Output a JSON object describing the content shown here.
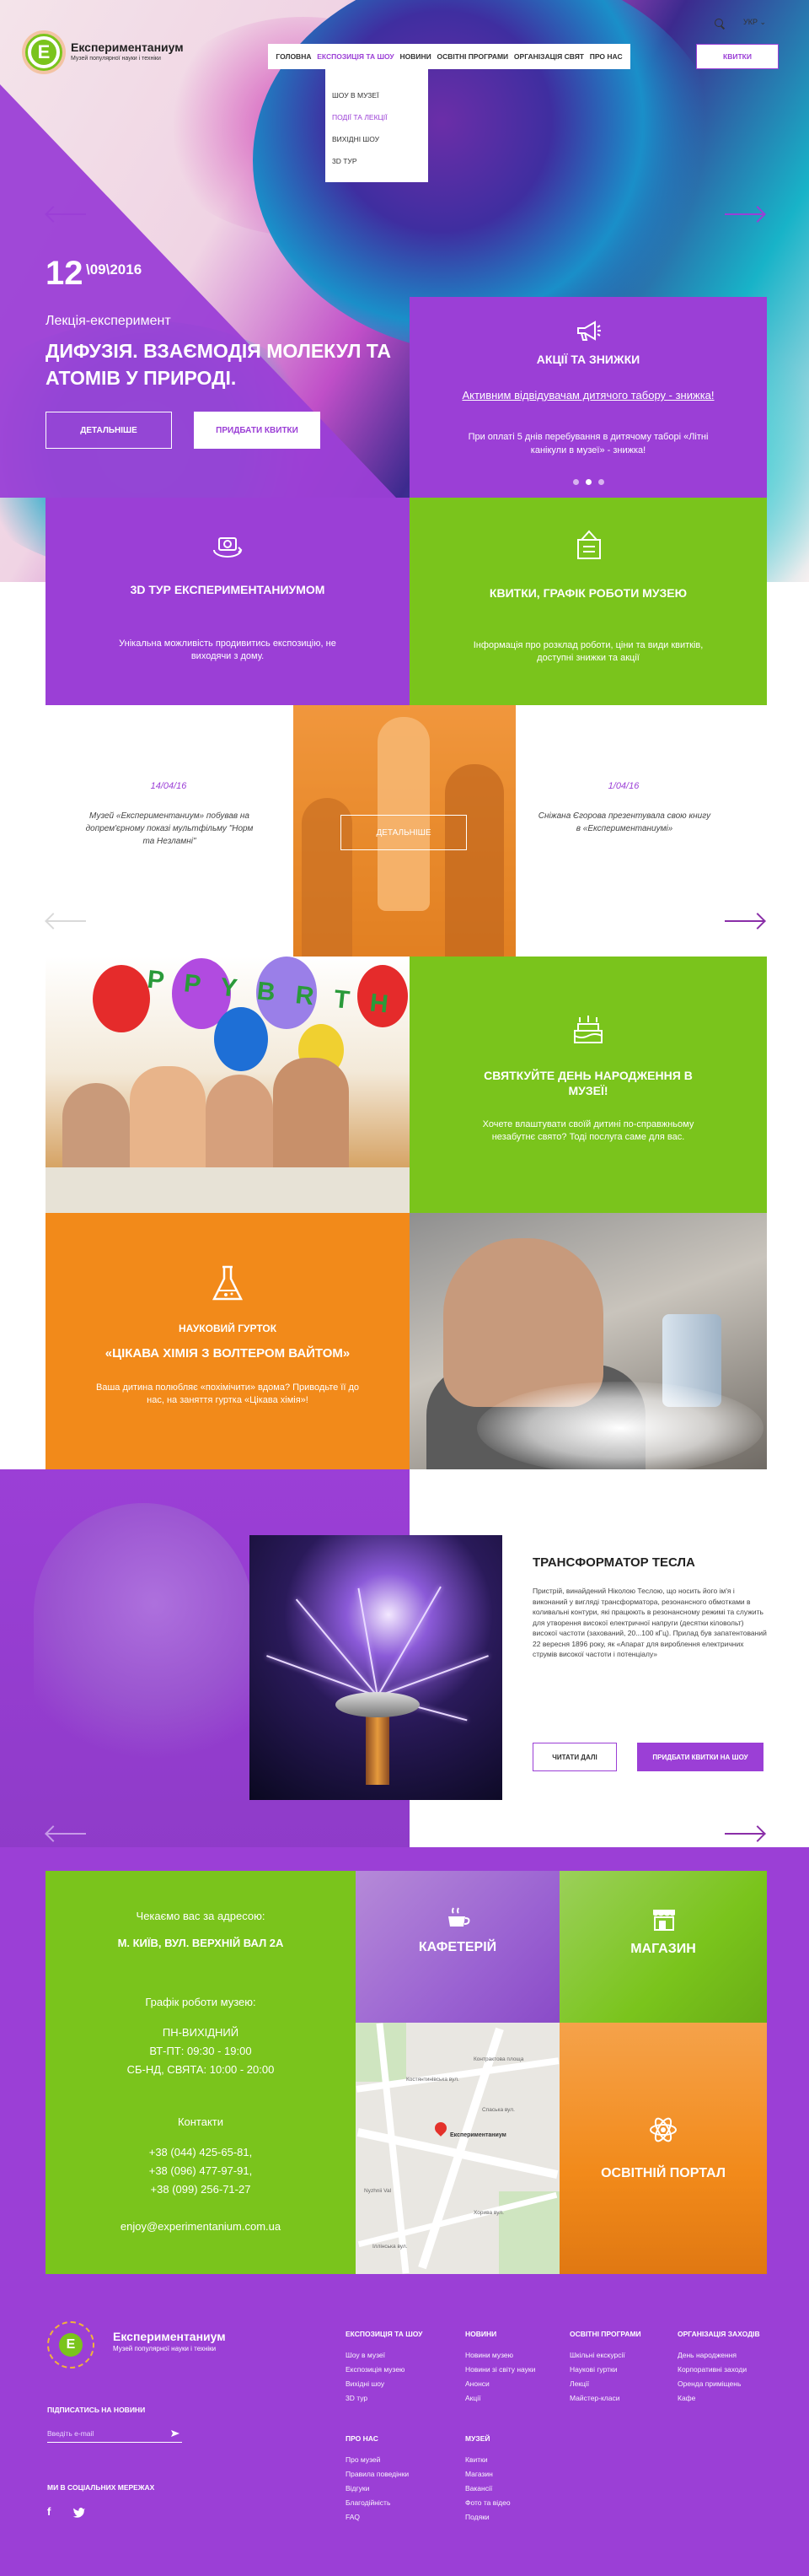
{
  "header": {
    "logo_letter": "E",
    "logo_name": "Експериментаниум",
    "logo_sub": "Музей популярної науки і техніки",
    "lang": "УКР ⌄",
    "tickets_button": "Квитки",
    "nav": [
      {
        "label": "Головна"
      },
      {
        "label": "Експозиція та шоу",
        "active": true
      },
      {
        "label": "Новини"
      },
      {
        "label": "Освітні програми"
      },
      {
        "label": "Організація свят"
      },
      {
        "label": "Про нас"
      }
    ],
    "dropdown": [
      {
        "label": "Шоу в музеї"
      },
      {
        "label": "Події та лекції",
        "active": true
      },
      {
        "label": "Вихідні шоу"
      },
      {
        "label": "3D тур"
      }
    ]
  },
  "hero": {
    "date_day": "12",
    "date_rest": "\\09\\2016",
    "event_type": "Лекція-експеримент",
    "event_title": "Дифузія. Взаємодія молекул та атомів у природі.",
    "details_button": "Детальніше",
    "buy_button": "Придбати квитки"
  },
  "promo": {
    "title": "Акції та знижки",
    "link": "Активним відвідувачам дитячого табору - знижка!",
    "text": "При оплаті 5 днів перебування в дитячому таборі «Літні канікули в музеї» - знижка!",
    "dots": 3,
    "active_dot": 1
  },
  "tiles": {
    "tour": {
      "title": "3D тур Експериментаниумом",
      "text": "Унікальна можливість продивитись експозицію, не виходячи з дому."
    },
    "tickets": {
      "title": "Квитки, графік роботи музею",
      "text": "Інформація про розклад роботи, ціни та види квитків, доступні знижки та акції"
    }
  },
  "news": {
    "left": {
      "date": "14/04/16",
      "text": "Музей «Експериментаниум» побував на допрем'єрному показі мультфільму \"Норм та Незламні\""
    },
    "right": {
      "date": "1/04/16",
      "text": "Сніжана Єгорова презентувала свою книгу в «Експериментаниумі»"
    },
    "details_button": "Детальніше"
  },
  "birthday": {
    "title": "Святкуйте день народження в музеї!",
    "text": "Хочете влаштувати своїй дитині по-справжньому незабутнє свято? Тоді послуга саме для вас.",
    "balloon_letters": "P P Y  B R T H"
  },
  "chemistry": {
    "subtitle": "Науковий гурток",
    "title": "«Цікава хімія з Волтером Вайтом»",
    "text": "Ваша дитина полюбляє «похімічити» вдома? Приводьте її до нас, на заняття гуртка «Цікава хімія»!"
  },
  "tesla": {
    "title": "Трансформатор Тесла",
    "text": "Пристрій, винайдений Ніколою Теслою, що носить його ім'я і виконаний у вигляді трансформатора, резонансного обмотками в коливальні контури, які працюють в резонансному режимі та служить для утворення високої електричної напруги (десятки кіловольт) високої частоти (захований, 20...100 кГц). Прилад був запатентований 22 вересня 1896 року, як «Апарат для вироблення електричних струмів високої частоти і потенціалу»",
    "read_button": "Читати далі",
    "buy_button": "Придбати квитки на шоу"
  },
  "contacts": {
    "address_intro": "Чекаємо вас за адресою:",
    "address": "м. Київ, вул. Верхній Вал 2А",
    "hours_title": "Графік роботи музею:",
    "hours": [
      "ПН-ВИХІДНИЙ",
      "ВТ-ПТ: 09:30 - 19:00",
      "СБ-НД, СВЯТА: 10:00 - 20:00"
    ],
    "contacts_title": "Контакти",
    "phones": [
      "+38 (044) 425-65-81,",
      "+38 (096) 477-97-91,",
      "+38 (099) 256-71-27"
    ],
    "email": "enjoy@experimentanium.com.ua",
    "cafe": "Кафетерій",
    "shop": "Магазин",
    "portal": "Освітній портал",
    "map_pin_label": "Експериментаниум",
    "map_labels": [
      "Контрактова площа",
      "Костянтинівська вул.",
      "Спаська вул.",
      "Nyzhnii Val",
      "Хорива вул.",
      "Іллінська вул."
    ]
  },
  "footer": {
    "logo_name": "Експериментаниум",
    "logo_sub": "Музей популярної науки і техніки",
    "subscribe_title": "Підписатись на новини",
    "subscribe_placeholder": "Введіть e-mail",
    "social_title": "Ми в соціальних мережах",
    "columns": [
      {
        "title": "Експозиція та шоу",
        "links": [
          "Шоу в музеї",
          "Експозиція музею",
          "Вихідні шоу",
          "3D тур"
        ]
      },
      {
        "title": "Новини",
        "links": [
          "Новини музею",
          "Новини зі світу науки",
          "Анонси",
          "Акції"
        ]
      },
      {
        "title": "Освітні програми",
        "links": [
          "Шкільні екскурсії",
          "Наукові гуртки",
          "Лекції",
          "Майстер-класи"
        ]
      },
      {
        "title": "Організація заходів",
        "links": [
          "День народження",
          "Корпоративні заходи",
          "Оренда приміщень",
          "Кафе"
        ]
      },
      {
        "title": "Про нас",
        "links": [
          "Про музей",
          "Правила поведінки",
          "Відгуки",
          "Благодійність",
          "FAQ"
        ]
      },
      {
        "title": "Музей",
        "links": [
          "Квитки",
          "Магазин",
          "Вакансії",
          "Фото та відео",
          "Подяки"
        ]
      }
    ]
  },
  "colors": {
    "purple": "#9b3fd6",
    "green": "#7ac41c",
    "orange": "#f28a1a"
  }
}
